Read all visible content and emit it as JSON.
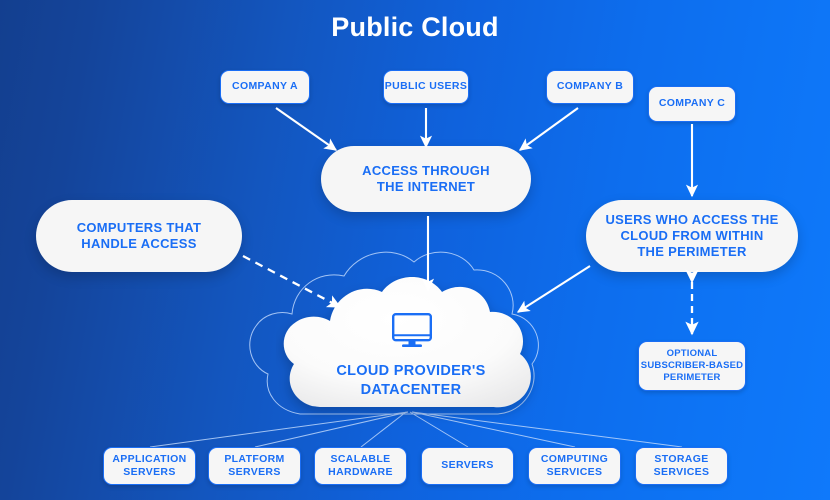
{
  "title": "Public Cloud",
  "colors": {
    "accent_text": "#1a6ef5",
    "box_fill": "#f6f6f6",
    "arrow": "#ffffff",
    "bg_left": "#133f8f",
    "bg_right": "#0f79fb"
  },
  "nodes": {
    "company_a": "COMPANY A",
    "public_users": "PUBLIC USERS",
    "company_b": "COMPANY B",
    "company_c": "COMPANY C",
    "access_internet_line1": "ACCESS THROUGH",
    "access_internet_line2": "THE INTERNET",
    "computers_line1": "COMPUTERS THAT",
    "computers_line2": "HANDLE ACCESS",
    "users_perimeter_line1": "USERS WHO ACCESS THE",
    "users_perimeter_line2": "CLOUD FROM WITHIN",
    "users_perimeter_line3": "THE PERIMETER",
    "optional_line1": "OPTIONAL",
    "optional_line2": "SUBSCRIBER-BASED",
    "optional_line3": "PERIMETER",
    "cloud_line1": "CLOUD PROVIDER'S",
    "cloud_line2": "DATACENTER"
  },
  "services": [
    {
      "line1": "APPLICATION",
      "line2": "SERVERS"
    },
    {
      "line1": "PLATFORM",
      "line2": "SERVERS"
    },
    {
      "line1": "SCALABLE",
      "line2": "HARDWARE"
    },
    {
      "line1": "SERVERS",
      "line2": ""
    },
    {
      "line1": "COMPUTING",
      "line2": "SERVICES"
    },
    {
      "line1": "STORAGE",
      "line2": "SERVICES"
    }
  ],
  "icons": {
    "datacenter": "desktop-monitor-icon"
  }
}
